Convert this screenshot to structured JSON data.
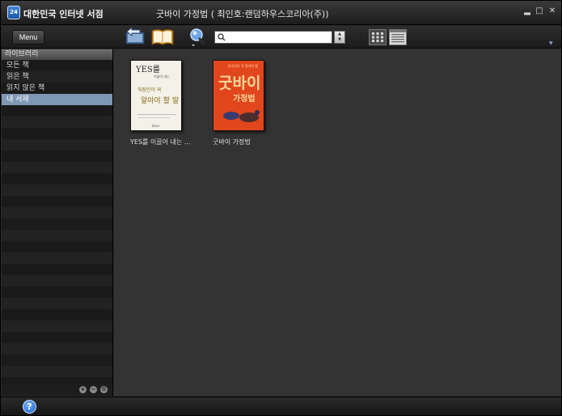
{
  "app": {
    "logo_text": "24",
    "name": "대한민국 인터넷 서점",
    "window_title": "굿바이 가정법 ( 최인호:랜덤하우스코리아(주))",
    "minimize_glyph": "▂",
    "maximize_glyph": "□",
    "close_glyph": "✕"
  },
  "toolbar": {
    "menu_label": "Menu",
    "search_value": "",
    "search_placeholder": "",
    "spin_up": "▲",
    "spin_down": "▼",
    "collapse_glyph": "▼"
  },
  "sidebar": {
    "header": "라이브러리",
    "items": [
      {
        "label": "모든 책",
        "selected": false
      },
      {
        "label": "읽은 책",
        "selected": false
      },
      {
        "label": "읽지 않은 책",
        "selected": false
      },
      {
        "label": "내 서재",
        "selected": true
      }
    ],
    "add_glyph": "+",
    "remove_glyph": "−",
    "settings_glyph": "⚙"
  },
  "books": [
    {
      "title": "YES를 이끌어 내는 ...",
      "cover_lines": [
        "YES를",
        "이끌어 내는",
        "직장인이 꼭",
        "알아야 할 말",
        "Bear"
      ]
    },
    {
      "title": "굿바이 가정법",
      "cover_lines": [
        "한국인이 꼭 알아야 할",
        "굿바이",
        "가정법"
      ]
    }
  ],
  "statusbar": {
    "help_glyph": "?"
  },
  "colors": {
    "accent_selected": "#7e97b5",
    "background": "#333333",
    "cover_orange": "#e2461d"
  }
}
